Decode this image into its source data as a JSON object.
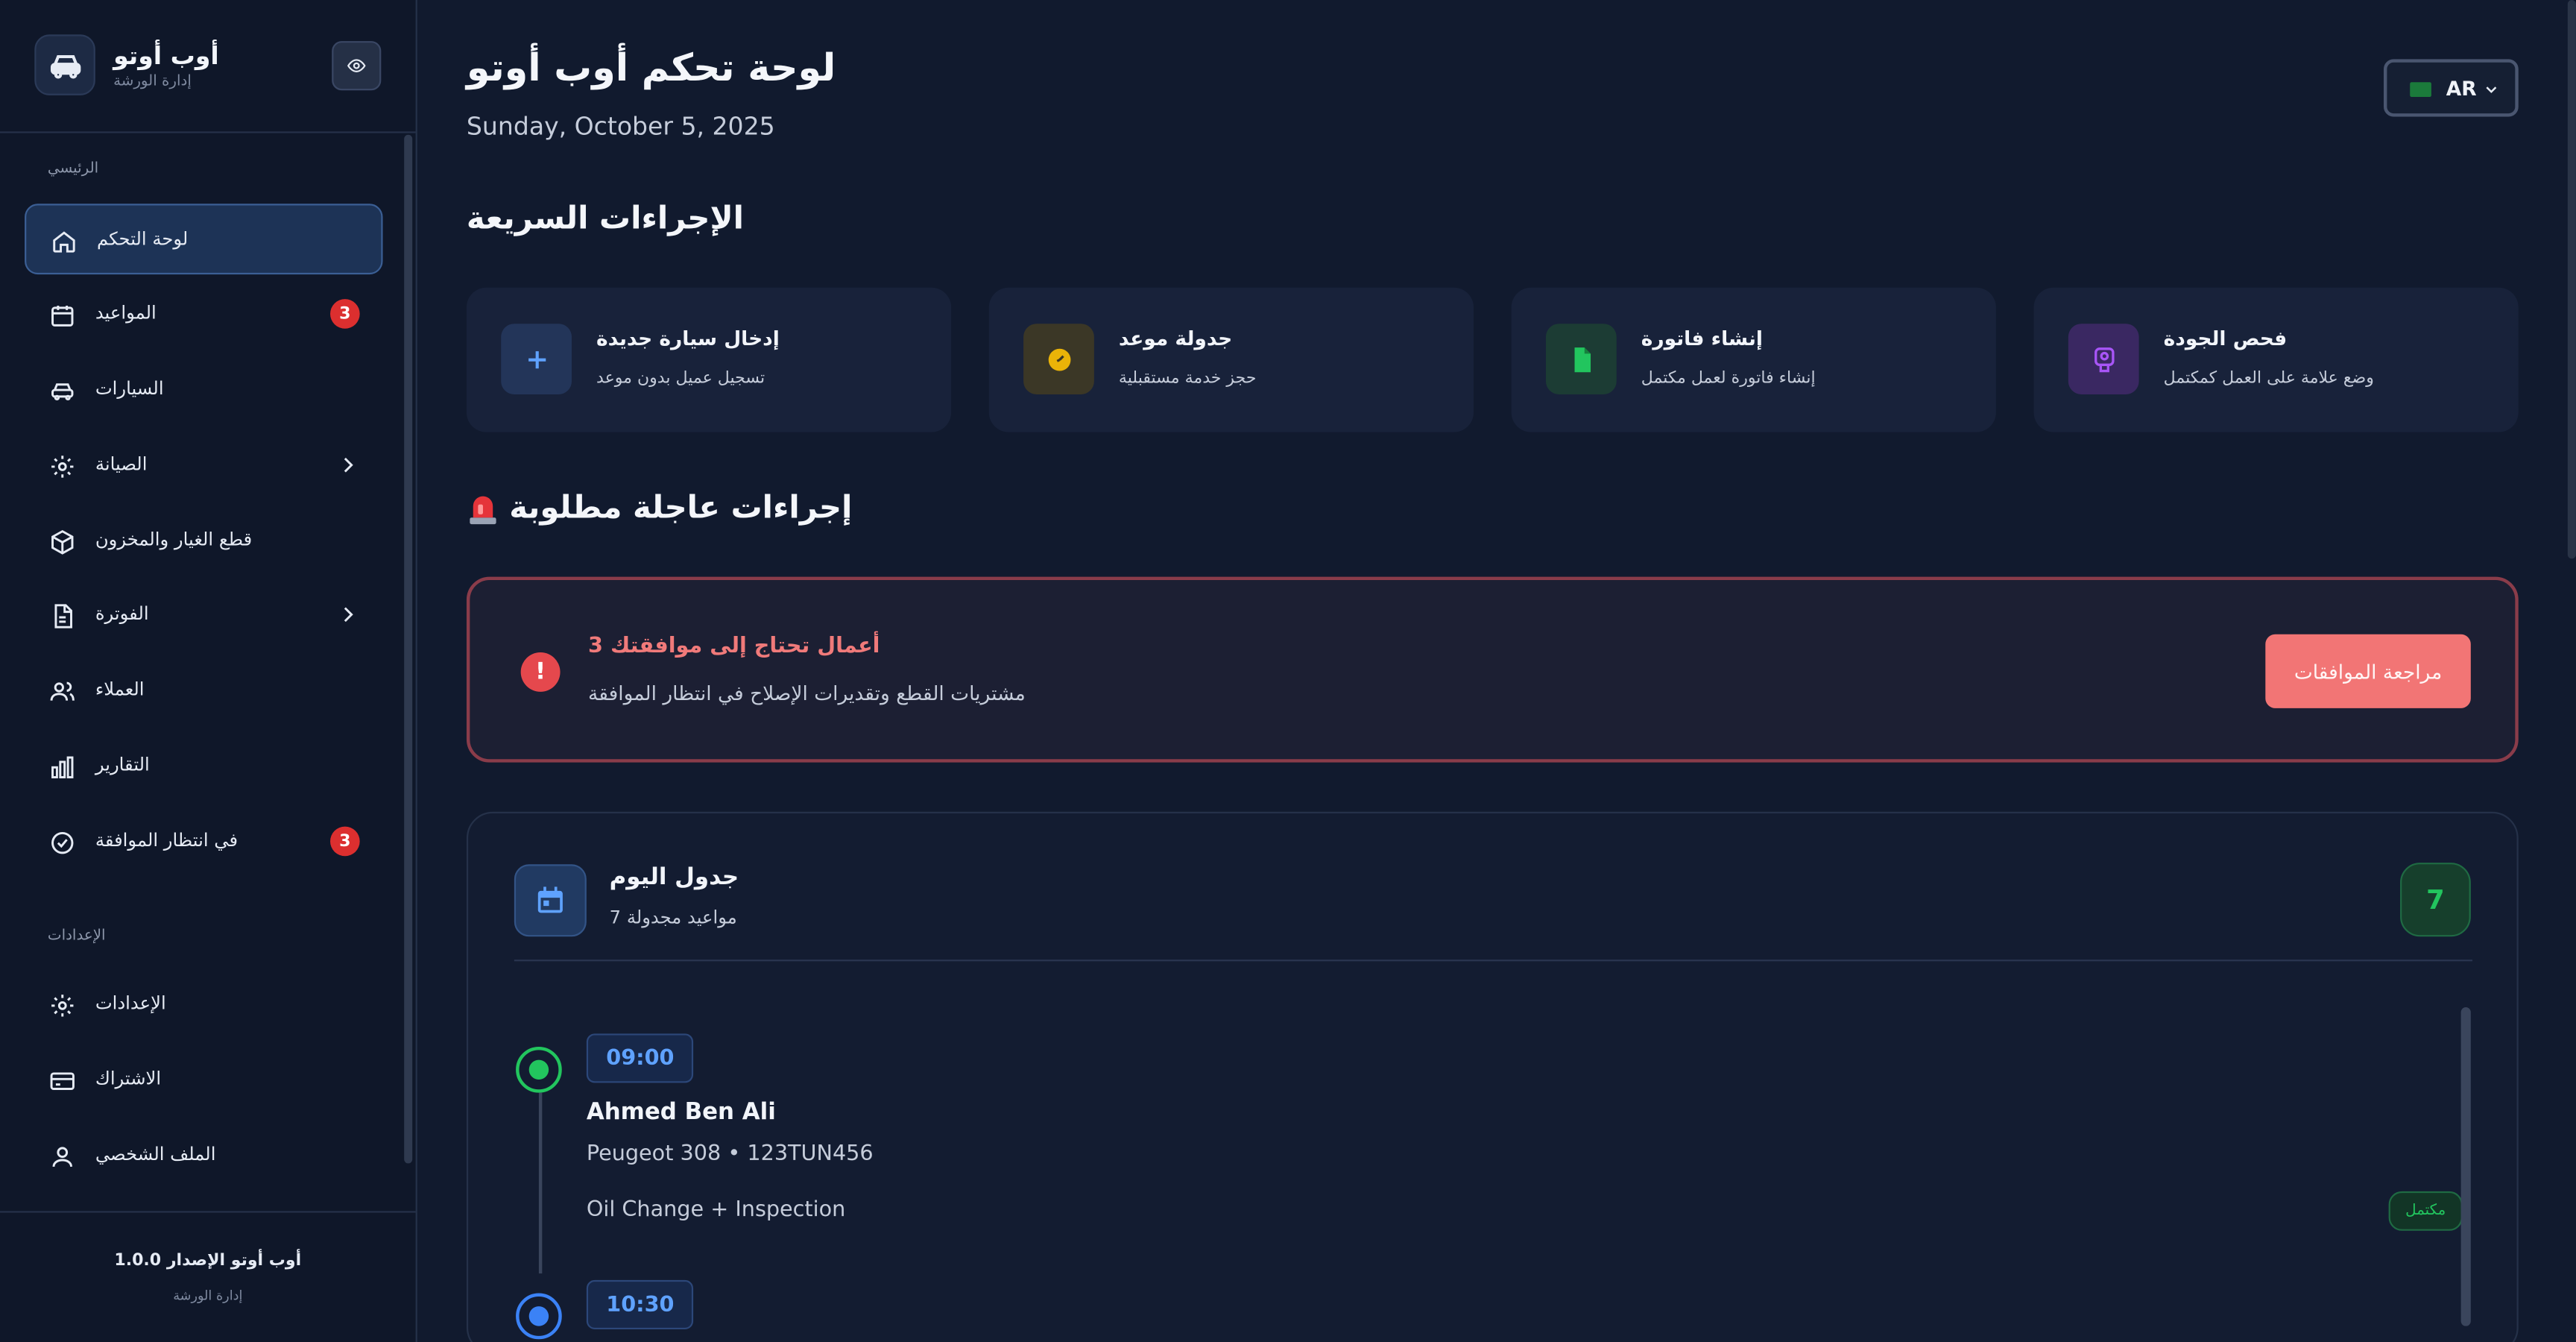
{
  "brand": {
    "name": "أوب أوتو",
    "subtitle": "إدارة الورشة"
  },
  "sidebar": {
    "section_main": "الرئيسي",
    "section_settings": "الإعدادات",
    "items": [
      {
        "label": "لوحة التحكم",
        "icon": "home-icon",
        "active": true
      },
      {
        "label": "المواعيد",
        "icon": "calendar-icon",
        "badge": "3"
      },
      {
        "label": "السيارات",
        "icon": "car-icon"
      },
      {
        "label": "الصيانة",
        "icon": "gear-icon",
        "expandable": true
      },
      {
        "label": "قطع الغيار والمخزون",
        "icon": "box-icon"
      },
      {
        "label": "الفوترة",
        "icon": "document-icon",
        "expandable": true
      },
      {
        "label": "العملاء",
        "icon": "users-icon"
      },
      {
        "label": "التقارير",
        "icon": "bar-chart-icon"
      },
      {
        "label": "في انتظار الموافقة",
        "icon": "check-circle-icon",
        "badge": "3"
      }
    ],
    "settings_items": [
      {
        "label": "الإعدادات",
        "icon": "gear-icon"
      },
      {
        "label": "الاشتراك",
        "icon": "credit-card-icon"
      },
      {
        "label": "الملف الشخصي",
        "icon": "user-icon"
      }
    ],
    "footer": {
      "version": "أوب أوتو الإصدار 1.0.0",
      "subtitle": "إدارة الورشة"
    }
  },
  "header": {
    "title": "لوحة تحكم أوب أوتو",
    "date": "Sunday, October 5, 2025",
    "language": "AR"
  },
  "quick_actions": {
    "title": "الإجراءات السريعة",
    "items": [
      {
        "title": "إدخال سيارة جديدة",
        "subtitle": "تسجيل عميل بدون موعد",
        "icon": "plus-icon",
        "color": "#3b82f6"
      },
      {
        "title": "جدولة موعد",
        "subtitle": "حجز خدمة مستقبلية",
        "icon": "clock-icon",
        "color": "#eab308"
      },
      {
        "title": "إنشاء فاتورة",
        "subtitle": "إنشاء فاتورة لعمل مكتمل",
        "icon": "file-icon",
        "color": "#22c55e"
      },
      {
        "title": "فحص الجودة",
        "subtitle": "وضع علامة على العمل كمكتمل",
        "icon": "badge-icon",
        "color": "#a855f7"
      }
    ]
  },
  "urgent": {
    "title": "إجراءات عاجلة مطلوبة",
    "alert_title": "3 أعمال تحتاج إلى موافقتك",
    "alert_subtitle": "مشتريات القطع وتقديرات الإصلاح في انتظار الموافقة",
    "button": "مراجعة الموافقات",
    "color": "#f27575"
  },
  "schedule": {
    "title": "جدول اليوم",
    "subtitle": "7 مواعيد مجدولة",
    "count": "7",
    "appointments": [
      {
        "time": "09:00",
        "name": "Ahmed Ben Ali",
        "car": "Peugeot 308 • 123TUN456",
        "service": "Oil Change + Inspection",
        "status": "مكتمل",
        "dot_color": "#22c55e"
      },
      {
        "time": "10:30",
        "dot_color": "#3b82f6"
      }
    ]
  }
}
